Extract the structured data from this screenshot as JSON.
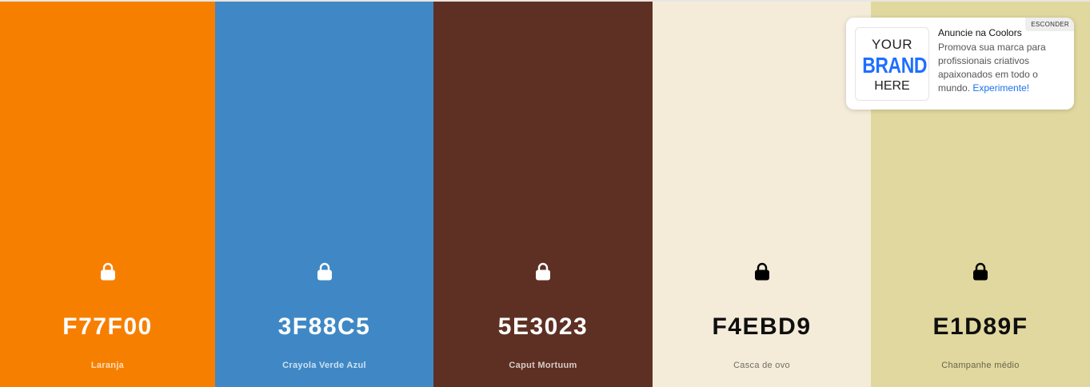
{
  "palette": {
    "colors": [
      {
        "hex": "F77F00",
        "name": "Laranja",
        "bg": "#F77F00",
        "tone": "light"
      },
      {
        "hex": "3F88C5",
        "name": "Crayola Verde Azul",
        "bg": "#3F88C5",
        "tone": "light"
      },
      {
        "hex": "5E3023",
        "name": "Caput Mortuum",
        "bg": "#5E3023",
        "tone": "light"
      },
      {
        "hex": "F4EBD9",
        "name": "Casca de ovo",
        "bg": "#F4EBD9",
        "tone": "dark"
      },
      {
        "hex": "E1D89F",
        "name": "Champanhe médio",
        "bg": "#E1D89F",
        "tone": "dark"
      }
    ],
    "lock_icon": "lock-icon"
  },
  "ad": {
    "logo_line1": "YOUR",
    "logo_line2": "BRAND",
    "logo_line3": "HERE",
    "title": "Anuncie na Coolors",
    "text": "Promova sua marca para profissionais criativos apaixonados em todo o mundo.",
    "cta": "Experimente!",
    "hide_label": "ESCONDER",
    "accent_color": "#1f6fff"
  }
}
